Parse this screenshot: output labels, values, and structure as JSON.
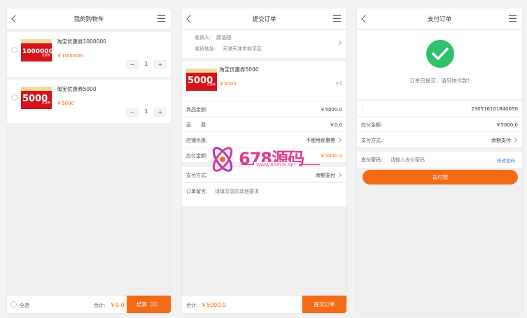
{
  "cart": {
    "title": "我的购物车",
    "items": [
      {
        "name": "淘宝优惠券1000000",
        "price": "￥1000000",
        "qty": "1",
        "thumb_value": "1000000",
        "thumb_tag": "优惠券"
      },
      {
        "name": "淘宝优惠券5000",
        "price": "￥5000",
        "qty": "1",
        "thumb_value": "5000",
        "thumb_tag": "优惠券"
      }
    ],
    "stepper_minus": "−",
    "stepper_plus": "+",
    "select_all": "全选",
    "total_label": "合计:",
    "total_value": "￥0.0",
    "checkout_button": "结算（0）"
  },
  "submit": {
    "title": "提交订单",
    "receiver_label": "收货人:",
    "receiver_name": "薛浩翔",
    "address_label": "收货地址:",
    "address_value": "天津天津市和平区",
    "item": {
      "name": "淘宝优惠券5000",
      "price": "￥5000",
      "qty": "×1",
      "thumb_value": "5000",
      "thumb_tag": "优惠券"
    },
    "rows": [
      {
        "key": "商品金额:",
        "value": "￥5000.0"
      },
      {
        "key": "运　　费:",
        "value": "￥0.0"
      },
      {
        "key": "店铺优惠:",
        "value": "不使用优惠券"
      },
      {
        "key": "应付金额:",
        "value": "￥5000.0"
      },
      {
        "key": "支付方式:",
        "value": "余额支付"
      }
    ],
    "remark_label": "订单留言:",
    "remark_placeholder": "请填写您的其他要求",
    "total_label": "合计:",
    "total_value": "￥5000.0",
    "submit_button": "提交订单"
  },
  "pay": {
    "title": "支付订单",
    "success_message": "订单已提交，请尽快付款!",
    "rows": [
      {
        "key": ":",
        "value": "230516101840650"
      },
      {
        "key": "应付金额:",
        "value": "￥5000.0"
      },
      {
        "key": "支付方式:",
        "value": "余额支付"
      }
    ],
    "password_label": "支付密码:",
    "password_placeholder": "请输入支付密码",
    "modify_link": "修改密码",
    "pay_button": "去付款"
  },
  "watermark": {
    "brand": "678源码",
    "url": "WWW.678YM.NET"
  },
  "colors": {
    "accent": "#f56a14",
    "price": "#ff6600",
    "success": "#2ec26b",
    "coupon_red": "#d4141c"
  }
}
